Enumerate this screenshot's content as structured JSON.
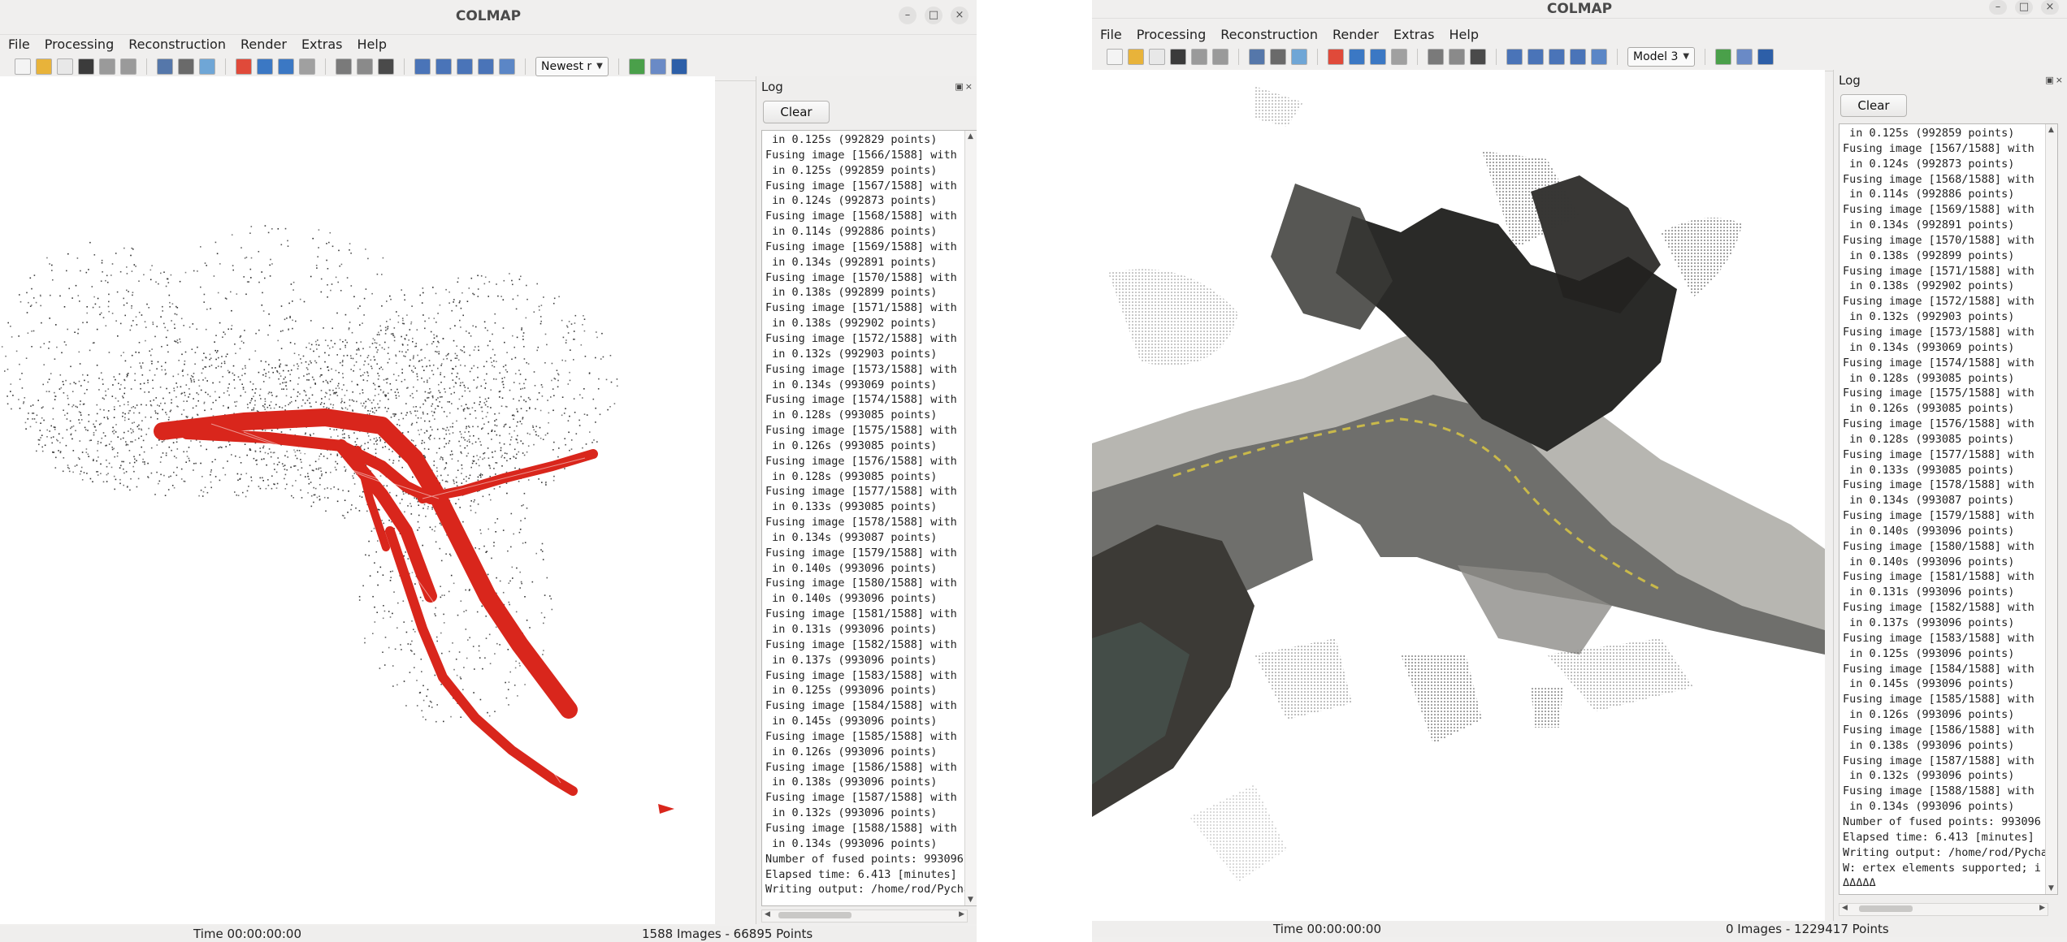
{
  "left_window": {
    "title": "COLMAP",
    "window_controls": [
      "–",
      "□",
      "×"
    ],
    "menu": [
      "File",
      "Processing",
      "Reconstruction",
      "Render",
      "Extras",
      "Help"
    ],
    "model_select": "Newest r",
    "log": {
      "title": "Log",
      "clear_label": "Clear",
      "text": " in 0.125s (992829 points)\nFusing image [1566/1588] with\n in 0.125s (992859 points)\nFusing image [1567/1588] with\n in 0.124s (992873 points)\nFusing image [1568/1588] with\n in 0.114s (992886 points)\nFusing image [1569/1588] with\n in 0.134s (992891 points)\nFusing image [1570/1588] with\n in 0.138s (992899 points)\nFusing image [1571/1588] with\n in 0.138s (992902 points)\nFusing image [1572/1588] with\n in 0.132s (992903 points)\nFusing image [1573/1588] with\n in 0.134s (993069 points)\nFusing image [1574/1588] with\n in 0.128s (993085 points)\nFusing image [1575/1588] with\n in 0.126s (993085 points)\nFusing image [1576/1588] with\n in 0.128s (993085 points)\nFusing image [1577/1588] with\n in 0.133s (993085 points)\nFusing image [1578/1588] with\n in 0.134s (993087 points)\nFusing image [1579/1588] with\n in 0.140s (993096 points)\nFusing image [1580/1588] with\n in 0.140s (993096 points)\nFusing image [1581/1588] with\n in 0.131s (993096 points)\nFusing image [1582/1588] with\n in 0.137s (993096 points)\nFusing image [1583/1588] with\n in 0.125s (993096 points)\nFusing image [1584/1588] with\n in 0.145s (993096 points)\nFusing image [1585/1588] with\n in 0.126s (993096 points)\nFusing image [1586/1588] with\n in 0.138s (993096 points)\nFusing image [1587/1588] with\n in 0.132s (993096 points)\nFusing image [1588/1588] with\n in 0.134s (993096 points)\nNumber of fused points: 993096\nElapsed time: 6.413 [minutes]\nWriting output: /home/rod/Pycha"
    },
    "status": {
      "time": "Time 00:00:00:00",
      "counts": "1588 Images - 66895 Points"
    }
  },
  "right_window": {
    "title": "COLMAP",
    "window_controls": [
      "–",
      "□",
      "×"
    ],
    "menu": [
      "File",
      "Processing",
      "Reconstruction",
      "Render",
      "Extras",
      "Help"
    ],
    "model_select": "Model 3",
    "log": {
      "title": "Log",
      "clear_label": "Clear",
      "text": " in 0.125s (992859 points)\nFusing image [1567/1588] with\n in 0.124s (992873 points)\nFusing image [1568/1588] with\n in 0.114s (992886 points)\nFusing image [1569/1588] with\n in 0.134s (992891 points)\nFusing image [1570/1588] with\n in 0.138s (992899 points)\nFusing image [1571/1588] with\n in 0.138s (992902 points)\nFusing image [1572/1588] with\n in 0.132s (992903 points)\nFusing image [1573/1588] with\n in 0.134s (993069 points)\nFusing image [1574/1588] with\n in 0.128s (993085 points)\nFusing image [1575/1588] with\n in 0.126s (993085 points)\nFusing image [1576/1588] with\n in 0.128s (993085 points)\nFusing image [1577/1588] with\n in 0.133s (993085 points)\nFusing image [1578/1588] with\n in 0.134s (993087 points)\nFusing image [1579/1588] with\n in 0.140s (993096 points)\nFusing image [1580/1588] with\n in 0.140s (993096 points)\nFusing image [1581/1588] with\n in 0.131s (993096 points)\nFusing image [1582/1588] with\n in 0.137s (993096 points)\nFusing image [1583/1588] with\n in 0.125s (993096 points)\nFusing image [1584/1588] with\n in 0.145s (993096 points)\nFusing image [1585/1588] with\n in 0.126s (993096 points)\nFusing image [1586/1588] with\n in 0.138s (993096 points)\nFusing image [1587/1588] with\n in 0.132s (993096 points)\nFusing image [1588/1588] with\n in 0.134s (993096 points)\nNumber of fused points: 993096\nElapsed time: 6.413 [minutes]\nWriting output: /home/rod/Pycha\nW: ertex elements supported; i\nΔΔΔΔΔ"
    },
    "status": {
      "time": "Time 00:00:00:00",
      "counts": "0 Images - 1229417 Points"
    }
  },
  "toolbar_icons": [
    "new-project-icon",
    "open-project-icon",
    "edit-project-icon",
    "save-project-icon",
    "import-model-icon",
    "export-model-icon",
    "feature-extraction-icon",
    "feature-matching-icon",
    "database-icon",
    "start-reconstruction-icon",
    "play-icon",
    "step-icon",
    "pause-icon",
    "bundle-adjustment-icon",
    "dense-reconstruction-icon",
    "render-options-icon",
    "zoom-in-icon",
    "zoom-out-icon",
    "reset-view-icon",
    "grab-image-icon",
    "grab-movie-icon",
    "reconstruction-stats-icon",
    "match-matrix-icon",
    "log-icon"
  ],
  "colors": {
    "camera_red": "#d9261c",
    "window_bg": "#f0efee"
  }
}
